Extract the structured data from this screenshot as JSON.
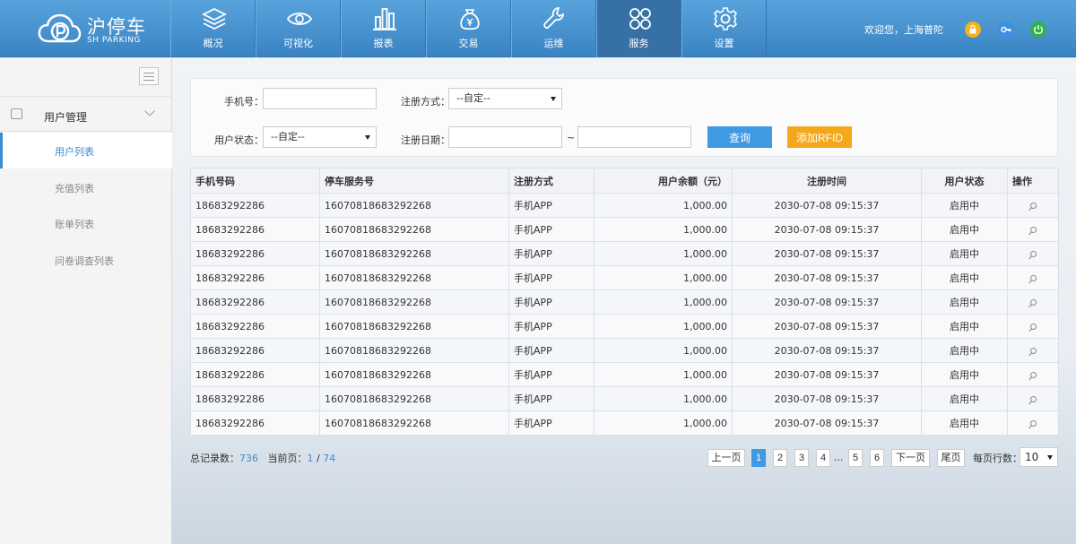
{
  "header": {
    "logo_cn": "沪停车",
    "logo_en": "SH PARKING",
    "nav": [
      {
        "label": "概况",
        "icon": "layers-icon"
      },
      {
        "label": "可视化",
        "icon": "eye-icon"
      },
      {
        "label": "报表",
        "icon": "bar-chart-icon"
      },
      {
        "label": "交易",
        "icon": "money-bag-icon"
      },
      {
        "label": "运维",
        "icon": "wrench-icon"
      },
      {
        "label": "服务",
        "icon": "grid-icon",
        "active": true
      },
      {
        "label": "设置",
        "icon": "gear-icon"
      }
    ],
    "welcome": "欢迎您，上海普陀",
    "colors": {
      "header": "#4a95d3",
      "lock": "#f3b21f",
      "key": "#3d8fe0",
      "power": "#2fb24c"
    }
  },
  "sidebar": {
    "group": "用户管理",
    "items": [
      "用户列表",
      "充值列表",
      "账单列表",
      "问卷调查列表"
    ],
    "active_index": 0
  },
  "filters": {
    "phone_label": "手机号：",
    "phone_value": "",
    "reg_method_label": "注册方式：",
    "reg_method_value": "--自定--",
    "status_label": "用户状态：",
    "status_value": "--自定--",
    "reg_date_label": "注册日期：",
    "date_from": "",
    "date_to": "",
    "tilde": "~",
    "query_label": "查询",
    "add_label": "添加RFID"
  },
  "table": {
    "headers": [
      "手机号码",
      "停车服务号",
      "注册方式",
      "用户余额（元）",
      "注册时间",
      "用户状态",
      "操作"
    ],
    "rows": [
      [
        "18683292286",
        "16070818683292268",
        "手机APP",
        "1,000.00",
        "2030-07-08 09:15:37",
        "启用中"
      ],
      [
        "18683292286",
        "16070818683292268",
        "手机APP",
        "1,000.00",
        "2030-07-08 09:15:37",
        "启用中"
      ],
      [
        "18683292286",
        "16070818683292268",
        "手机APP",
        "1,000.00",
        "2030-07-08 09:15:37",
        "启用中"
      ],
      [
        "18683292286",
        "16070818683292268",
        "手机APP",
        "1,000.00",
        "2030-07-08 09:15:37",
        "启用中"
      ],
      [
        "18683292286",
        "16070818683292268",
        "手机APP",
        "1,000.00",
        "2030-07-08 09:15:37",
        "启用中"
      ],
      [
        "18683292286",
        "16070818683292268",
        "手机APP",
        "1,000.00",
        "2030-07-08 09:15:37",
        "启用中"
      ],
      [
        "18683292286",
        "16070818683292268",
        "手机APP",
        "1,000.00",
        "2030-07-08 09:15:37",
        "启用中"
      ],
      [
        "18683292286",
        "16070818683292268",
        "手机APP",
        "1,000.00",
        "2030-07-08 09:15:37",
        "启用中"
      ],
      [
        "18683292286",
        "16070818683292268",
        "手机APP",
        "1,000.00",
        "2030-07-08 09:15:37",
        "启用中"
      ],
      [
        "18683292286",
        "16070818683292268",
        "手机APP",
        "1,000.00",
        "2030-07-08 09:15:37",
        "启用中"
      ]
    ],
    "action_icon": "search-icon"
  },
  "footer": {
    "total_label": "总记录数：",
    "total": "736",
    "current_label": "当前页：",
    "current_page": "1",
    "separator": "/",
    "total_pages": "74",
    "prev": "上一页",
    "pages": [
      "1",
      "2",
      "3",
      "4"
    ],
    "ellipsis": "...",
    "more_pages": [
      "5",
      "6"
    ],
    "next": "下一页",
    "last": "尾页",
    "rpp_label": "每页行数：",
    "rpp_value": "10"
  }
}
